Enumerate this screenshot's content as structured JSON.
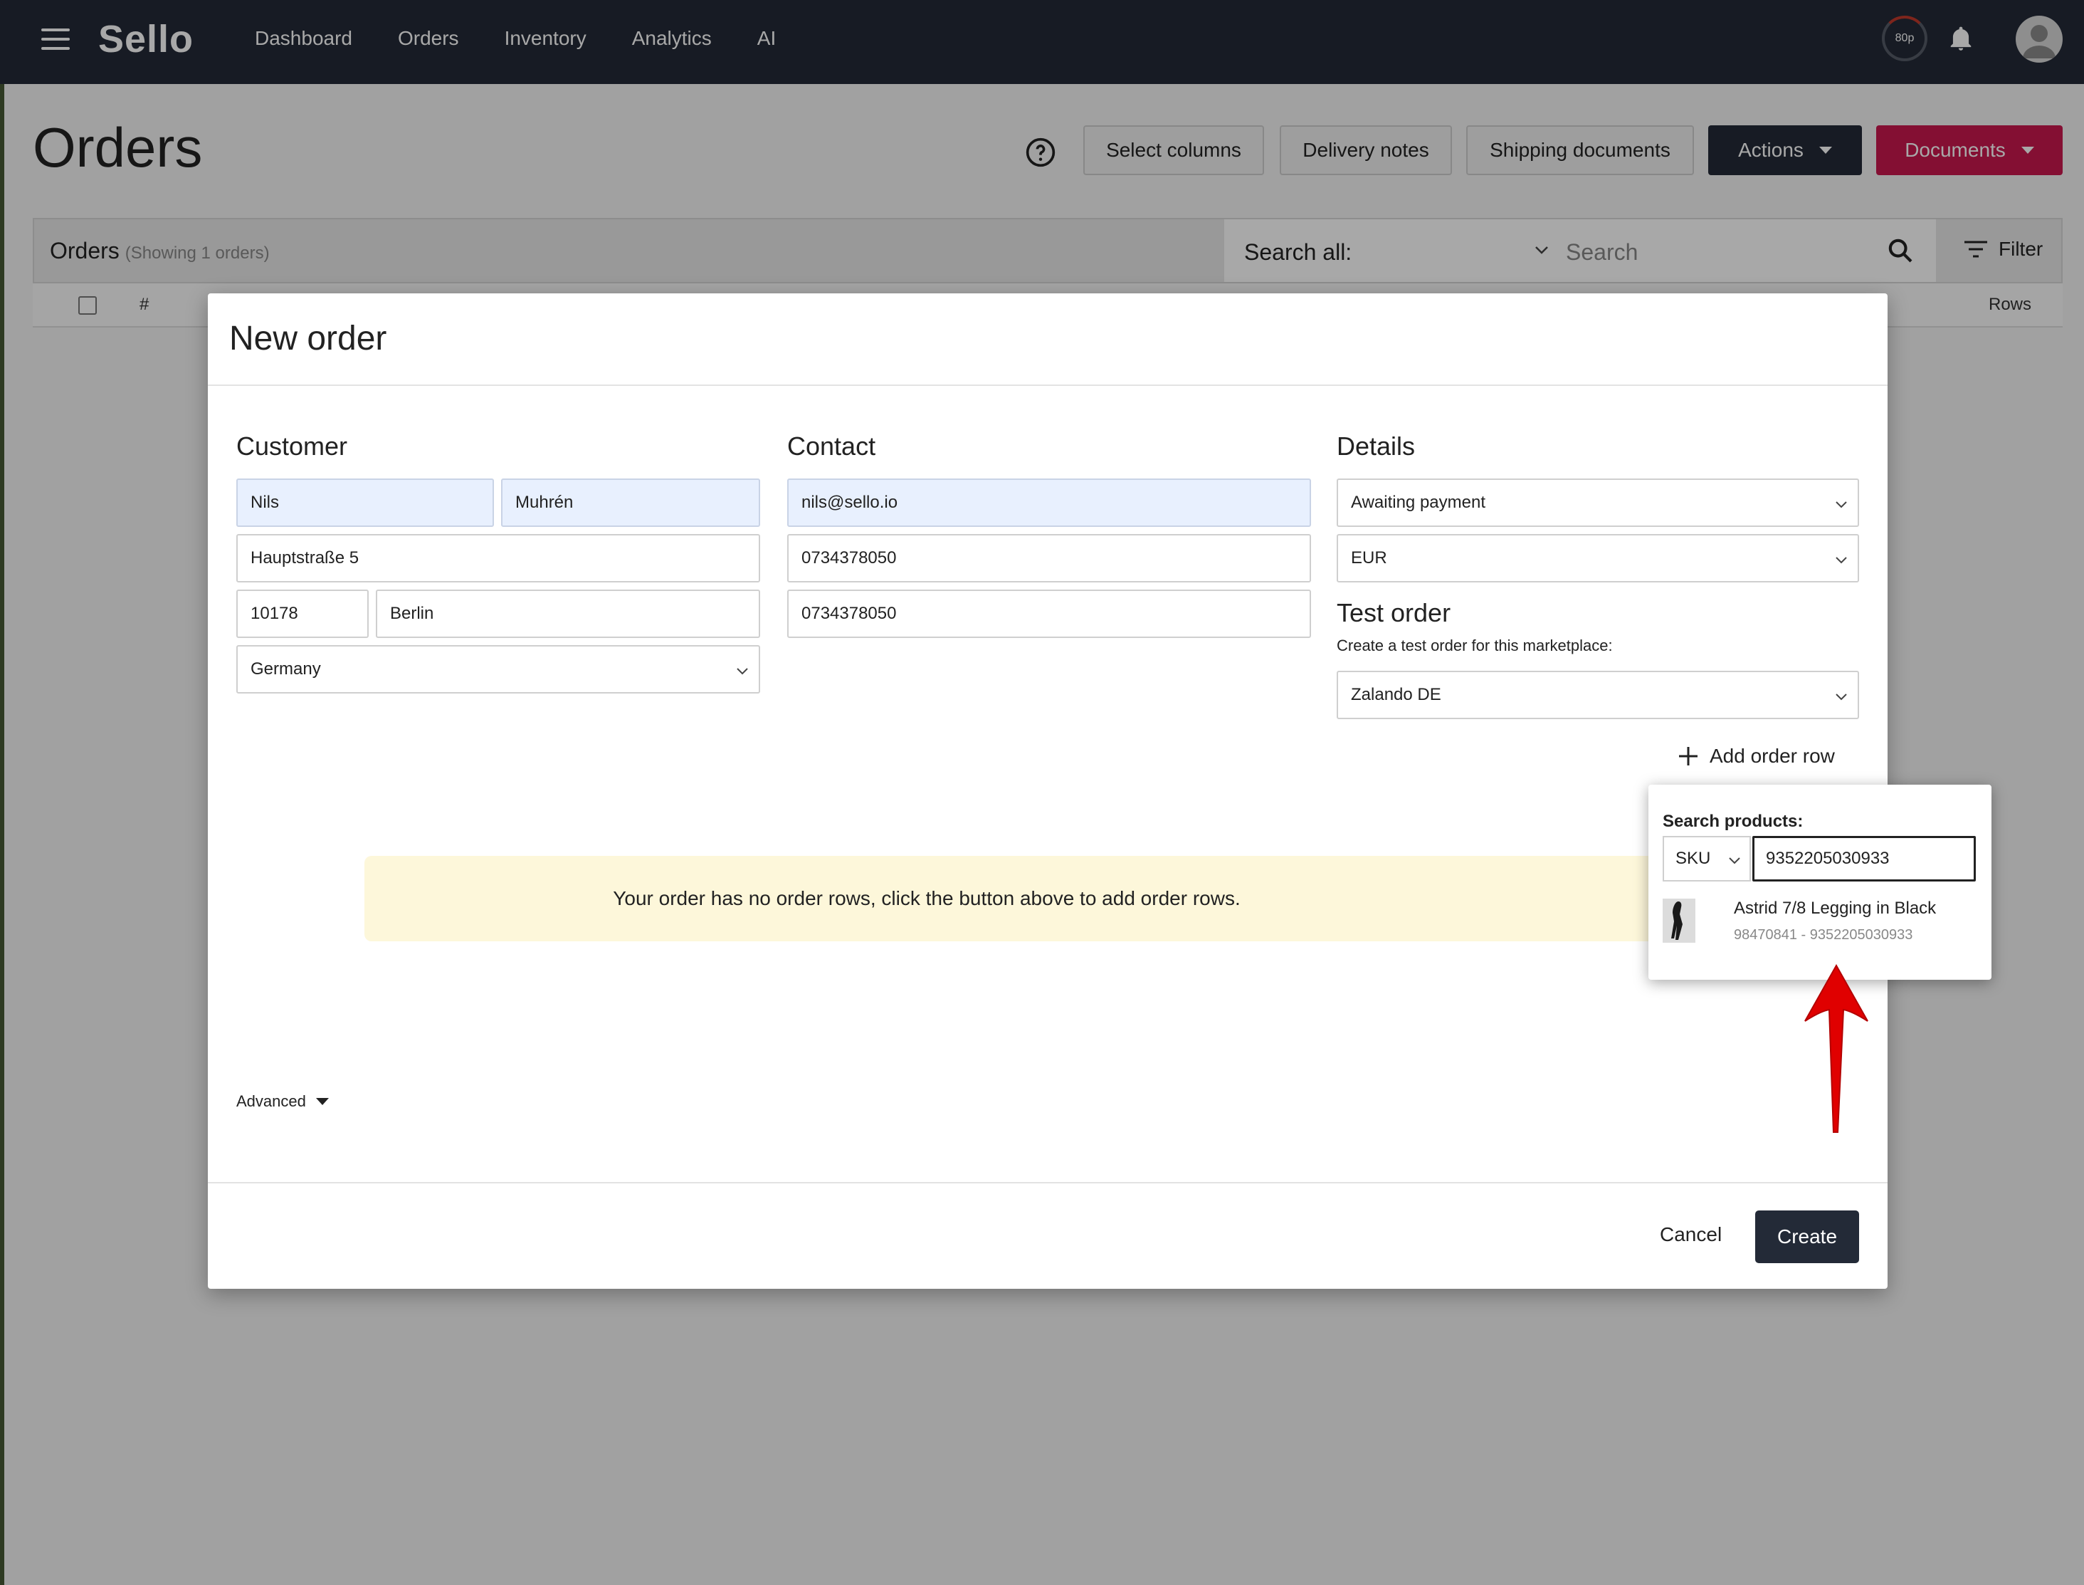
{
  "nav": {
    "logo": "Sello",
    "links": [
      "Dashboard",
      "Orders",
      "Inventory",
      "Analytics",
      "AI"
    ],
    "badge": "80p",
    "icons": [
      "menu-icon",
      "bell-icon",
      "user-avatar-icon"
    ]
  },
  "page": {
    "title": "Orders",
    "buttons": {
      "select_columns": "Select columns",
      "delivery_notes": "Delivery notes",
      "shipping_documents": "Shipping documents",
      "actions": "Actions",
      "documents": "Documents"
    },
    "orders_label": "Orders",
    "orders_count": "(Showing 1 orders)",
    "search_all_label": "Search all:",
    "search_placeholder": "Search",
    "filter": "Filter",
    "table_headers": {
      "hash": "#",
      "rows": "Rows"
    }
  },
  "modal": {
    "title": "New order",
    "customer": {
      "heading": "Customer",
      "first_name": "Nils",
      "last_name": "Muhrén",
      "street": "Hauptstraße 5",
      "zip": "10178",
      "city": "Berlin",
      "country": "Germany"
    },
    "contact": {
      "heading": "Contact",
      "email": "nils@sello.io",
      "phone": "0734378050",
      "mobile": "0734378050"
    },
    "details": {
      "heading": "Details",
      "status": "Awaiting payment",
      "currency": "EUR",
      "test_order_title": "Test order",
      "test_order_sub": "Create a test order for this marketplace:",
      "marketplace": "Zalando DE",
      "add_order_row": "Add order row"
    },
    "notice": "Your order has no order rows, click the button above to add order rows.",
    "advanced": "Advanced",
    "cancel": "Cancel",
    "create": "Create"
  },
  "product_search": {
    "label": "Search products:",
    "search_by": "SKU",
    "query": "9352205030933",
    "result_name": "Astrid 7/8 Legging in Black",
    "result_sku": "98470841 - 9352205030933"
  },
  "colors": {
    "nav_bg": "#232a37",
    "accent_red": "#c8174e",
    "notice_bg": "#fdf7da",
    "annotation_arrow": "#e00000"
  }
}
